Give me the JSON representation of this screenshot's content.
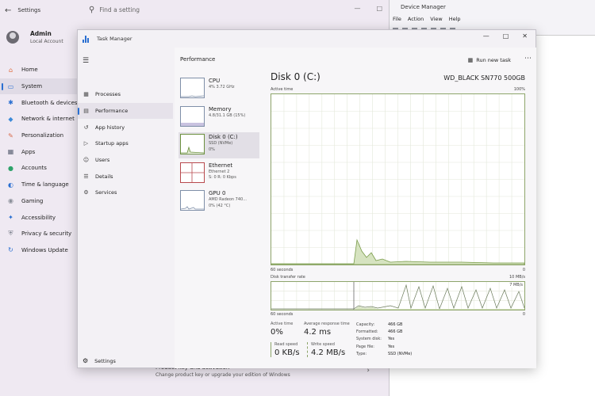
{
  "settings": {
    "title": "Settings",
    "search_placeholder": "Find a setting",
    "user": {
      "name": "Admin",
      "account": "Local Account"
    },
    "nav": [
      {
        "label": "Home",
        "icon": "home-icon",
        "color": "#e06b3d"
      },
      {
        "label": "System",
        "icon": "system-icon",
        "color": "#2a6fd1",
        "active": true
      },
      {
        "label": "Bluetooth & devices",
        "icon": "bluetooth-icon",
        "color": "#2a6fd1"
      },
      {
        "label": "Network & internet",
        "icon": "network-icon",
        "color": "#3c8ad8"
      },
      {
        "label": "Personalization",
        "icon": "brush-icon",
        "color": "#d86a4a"
      },
      {
        "label": "Apps",
        "icon": "apps-icon",
        "color": "#5a6173"
      },
      {
        "label": "Accounts",
        "icon": "accounts-icon",
        "color": "#2ea36a"
      },
      {
        "label": "Time & language",
        "icon": "globe-icon",
        "color": "#2a6fd1"
      },
      {
        "label": "Gaming",
        "icon": "gaming-icon",
        "color": "#8a8f99"
      },
      {
        "label": "Accessibility",
        "icon": "accessibility-icon",
        "color": "#2a6fd1"
      },
      {
        "label": "Privacy & security",
        "icon": "shield-icon",
        "color": "#7a7f8c"
      },
      {
        "label": "Windows Update",
        "icon": "update-icon",
        "color": "#2a6fd1"
      }
    ],
    "bottom_row": {
      "title": "Product key and activation",
      "subtitle": "Change product key or upgrade your edition of Windows"
    }
  },
  "device_manager": {
    "title": "Device Manager",
    "menu": [
      "File",
      "Action",
      "View",
      "Help"
    ]
  },
  "task_manager": {
    "title": "Task Manager",
    "nav": [
      {
        "label": "Processes",
        "icon": "processes-icon"
      },
      {
        "label": "Performance",
        "icon": "performance-icon",
        "active": true
      },
      {
        "label": "App history",
        "icon": "history-icon"
      },
      {
        "label": "Startup apps",
        "icon": "startup-icon"
      },
      {
        "label": "Users",
        "icon": "users-icon"
      },
      {
        "label": "Details",
        "icon": "details-icon"
      },
      {
        "label": "Services",
        "icon": "services-icon"
      }
    ],
    "settings_label": "Settings",
    "header": "Performance",
    "run_new_task": "Run new task",
    "devices": [
      {
        "name": "CPU",
        "sub1": "4%  3.72 GHz",
        "sub2": "",
        "type": "cpu"
      },
      {
        "name": "Memory",
        "sub1": "4.8/31.1 GB (15%)",
        "sub2": "",
        "type": "mem"
      },
      {
        "name": "Disk 0 (C:)",
        "sub1": "SSD (NVMe)",
        "sub2": "0%",
        "type": "disk",
        "active": true
      },
      {
        "name": "Ethernet",
        "sub1": "Ethernet 2",
        "sub2": "S: 0  R: 0 Kbps",
        "type": "eth"
      },
      {
        "name": "GPU 0",
        "sub1": "AMD Radeon 740...",
        "sub2": "0%  (42 °C)",
        "type": "gpu"
      }
    ],
    "disk": {
      "title": "Disk 0 (C:)",
      "model": "WD_BLACK SN770 500GB",
      "active_time_label": "Active time",
      "max_label": "100%",
      "time_label": "60 seconds",
      "zero_label": "0",
      "transfer_label": "Disk transfer rate",
      "transfer_max": "10 MB/s",
      "transfer_scale2": "7 MB/s",
      "time_label2": "60 seconds",
      "zero_label2": "0",
      "active_time": {
        "label": "Active time",
        "value": "0%"
      },
      "avg_response": {
        "label": "Average response time",
        "value": "4.2 ms"
      },
      "read_speed": {
        "label": "Read speed",
        "value": "0 KB/s"
      },
      "write_speed": {
        "label": "Write speed",
        "value": "4.2 MB/s"
      },
      "info": [
        {
          "k": "Capacity:",
          "v": "466 GB"
        },
        {
          "k": "Formatted:",
          "v": "466 GB"
        },
        {
          "k": "System disk:",
          "v": "Yes"
        },
        {
          "k": "Page file:",
          "v": "Yes"
        },
        {
          "k": "Type:",
          "v": "SSD (NVMe)"
        }
      ]
    }
  }
}
